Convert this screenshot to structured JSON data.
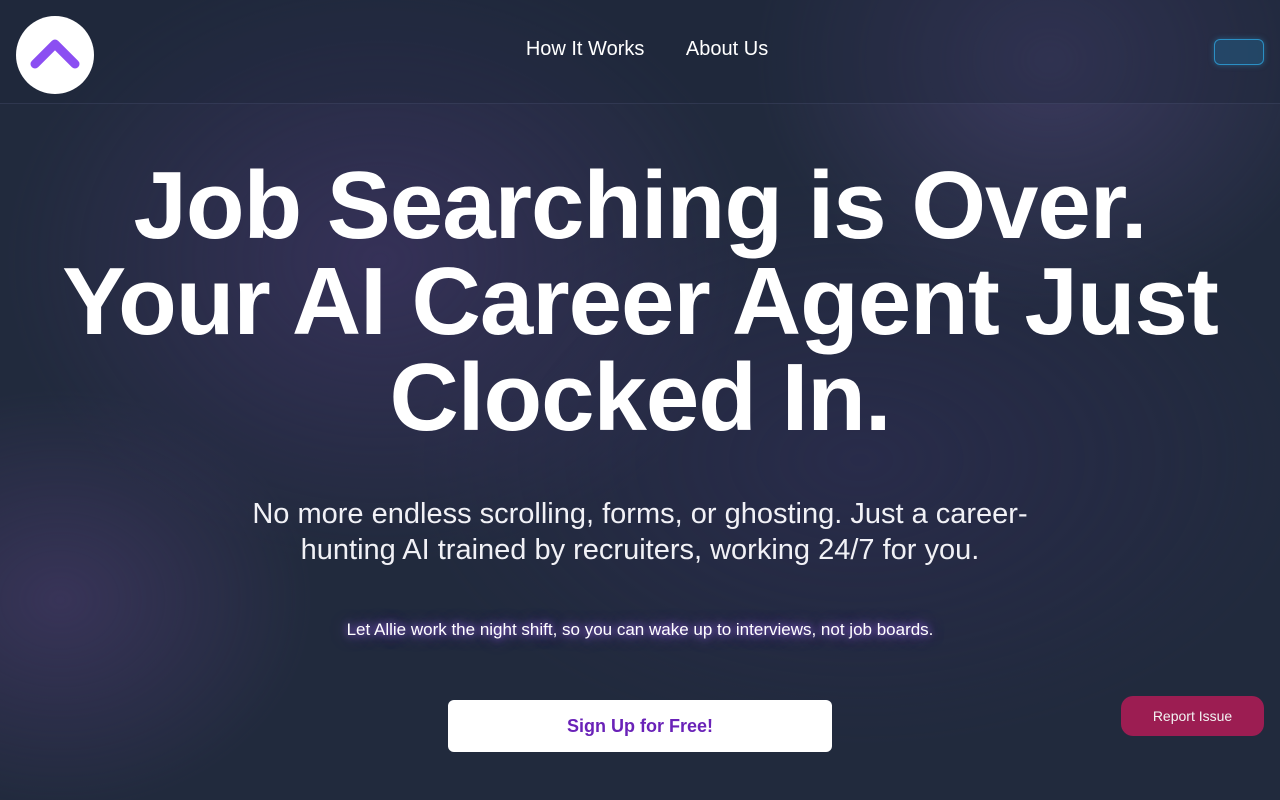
{
  "nav": {
    "logo_icon": "caret-up-logo-icon",
    "links": [
      {
        "label": "How It Works"
      },
      {
        "label": "About Us"
      }
    ],
    "cta_label": ""
  },
  "hero": {
    "title_lines": [
      "Job Searching is Over.",
      "Your AI Career Agent Just",
      "Clocked In."
    ],
    "subtitle": "No more endless scrolling, forms, or ghosting. Just a career-hunting AI trained by recruiters, working 24/7 for you.",
    "tagline": "Let Allie work the night shift, so you can wake up to interviews, not job boards.",
    "signup_label": "Sign Up for Free!"
  },
  "report_issue_label": "Report Issue",
  "colors": {
    "background": "#212a3d",
    "logo_accent": "#8b4ef2",
    "signup_text": "#6a22b8",
    "report_button": "#9c1d52",
    "nav_cta_border": "#2b8fc4"
  }
}
